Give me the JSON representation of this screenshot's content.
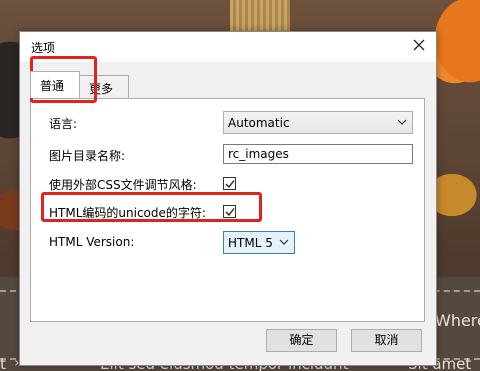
{
  "background": {
    "text_right": "Where",
    "text_bottom": "Elit sed eiusmod tempor incidunt",
    "text_bottom_left": "t",
    "text_bottom_right": "Sit amet"
  },
  "dialog": {
    "title": "选项",
    "close_icon": "close-icon",
    "tabs": [
      {
        "label": "普通",
        "active": true
      },
      {
        "label": "更多",
        "active": false
      }
    ],
    "fields": {
      "language": {
        "label": "语言:",
        "value": "Automatic"
      },
      "image_dir": {
        "label": "图片目录名称:",
        "value": "rc_images"
      },
      "external_css": {
        "label": "使用外部CSS文件调节风格:",
        "checked": true
      },
      "html_unicode": {
        "label": "HTML编码的unicode的字符:",
        "checked": true
      },
      "html_version": {
        "label": "HTML Version:",
        "value": "HTML 5"
      }
    },
    "buttons": {
      "ok": "确定",
      "cancel": "取消"
    }
  },
  "colors": {
    "highlight": "#e0231d",
    "dialog_bg": "#f0f0f0"
  }
}
